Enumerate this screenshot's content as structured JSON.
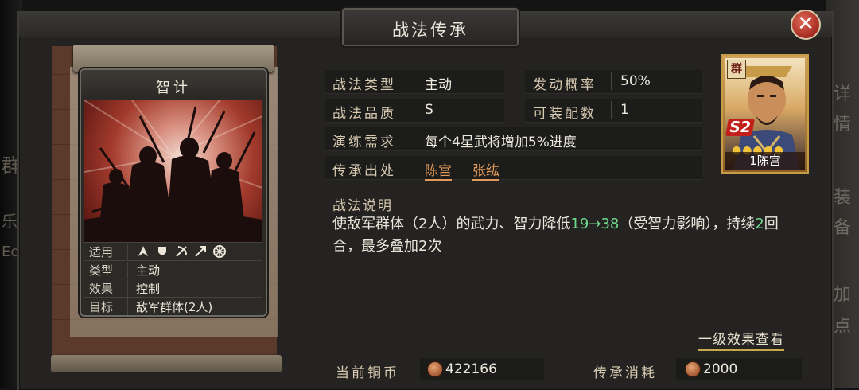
{
  "window": {
    "title": "战法传承"
  },
  "side_tabs": [
    "详",
    "情",
    "装",
    "备",
    "加",
    "点"
  ],
  "left_fragments": [
    "群",
    "乐",
    "Eo"
  ],
  "card": {
    "title": "智计",
    "rows": [
      {
        "label": "适用",
        "value": ""
      },
      {
        "label": "类型",
        "value": "主动"
      },
      {
        "label": "效果",
        "value": "控制"
      },
      {
        "label": "目标",
        "value": "敌军群体(2人)"
      }
    ],
    "unit_icons": [
      "cavalry-icon",
      "shield-infantry-icon",
      "bow-icon",
      "spear-icon",
      "wheel-icon"
    ]
  },
  "info": {
    "type_label": "战法类型",
    "type_value": "主动",
    "rate_label": "发动概率",
    "rate_value": "50%",
    "quality_label": "战法品质",
    "quality_value": "S",
    "equip_label": "可装配数",
    "equip_value": "1",
    "train_label": "演练需求",
    "train_value": "每个4星武将增加5%进度",
    "source_label": "传承出处",
    "source_names": [
      "陈宫",
      "张纮"
    ]
  },
  "description": {
    "title": "战法说明",
    "text_a": "使敌军群体（2人）的武力、智力降低",
    "value_change": "19→38",
    "text_b": "（受智力影响），持续",
    "rounds": "2",
    "text_c": "回合，最多叠加2次"
  },
  "level_link": "一级效果查看",
  "currency": {
    "copper_label": "当前铜币",
    "copper_value": "422166",
    "cost_label": "传承消耗",
    "cost_value": "2000"
  },
  "portrait": {
    "faction": "群",
    "rank": "S2",
    "stars": "●●●●●",
    "name": "1陈宫"
  },
  "colors": {
    "accent": "#e39a59",
    "green_number": "#6fd88b",
    "close_red": "#a62b20"
  }
}
